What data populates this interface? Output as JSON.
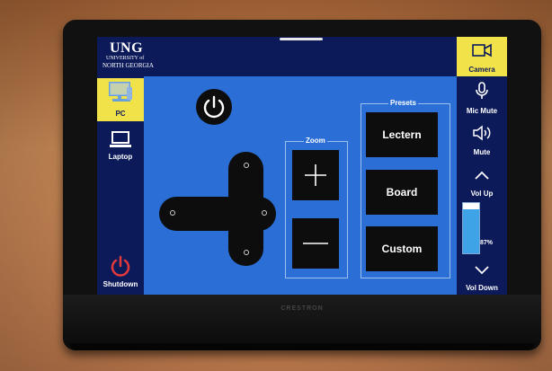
{
  "branding": {
    "logo_main": "UNG",
    "logo_sub1": "UNIVERSITY of",
    "logo_sub2": "NORTH GEORGIA",
    "device_brand": "CRESTRON"
  },
  "sources": [
    {
      "label": "PC",
      "icon": "desktop-pc-icon",
      "active": true
    },
    {
      "label": "Laptop",
      "icon": "laptop-icon",
      "active": false
    }
  ],
  "left_bottom": {
    "label": "Shutdown",
    "icon": "power-icon",
    "icon_color": "#e23a3a"
  },
  "right_controls": {
    "camera": {
      "label": "Camera",
      "icon": "camera-icon",
      "active": true
    },
    "mic_mute": {
      "label": "Mic Mute",
      "icon": "microphone-icon"
    },
    "mute": {
      "label": "Mute",
      "icon": "speaker-icon"
    },
    "vol_up": {
      "label": "Vol Up",
      "icon": "chevron-up-icon"
    },
    "vol_down": {
      "label": "Vol Down",
      "icon": "chevron-down-icon"
    },
    "volume_percent": "87%",
    "volume_level": 0.87
  },
  "main": {
    "power_icon": "power-icon",
    "dpad_icon": "direction-pad-icon",
    "zoom": {
      "title": "Zoom",
      "in_icon": "plus-icon",
      "out_icon": "minus-icon"
    },
    "presets": {
      "title": "Presets",
      "buttons": [
        "Lectern",
        "Board",
        "Custom"
      ]
    }
  },
  "colors": {
    "nav_bg": "#0c1a5a",
    "main_bg": "#2b6fd6",
    "active": "#f2e24a",
    "button_bg": "#0d0d0d"
  }
}
